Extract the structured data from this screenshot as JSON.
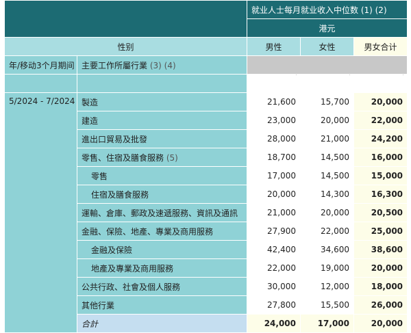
{
  "header": {
    "title": "就业人士每月就业收入中位数 (1) (2)",
    "unit": "港元",
    "col_gender_label": "性别",
    "col_male": "男性",
    "col_female": "女性",
    "col_total": "男女合计"
  },
  "subheader": {
    "period_label": "年/移动3个月期间",
    "industry_label": "主要工作所屬行業",
    "industry_note": "(3) (4)"
  },
  "period": "5/2024 - 7/2024",
  "rows": [
    {
      "label": "製造",
      "note": "",
      "male": "21,600",
      "female": "15,700",
      "total": "20,000"
    },
    {
      "label": "建造",
      "note": "",
      "male": "23,000",
      "female": "20,000",
      "total": "22,000"
    },
    {
      "label": "進出口貿易及批發",
      "note": "",
      "male": "28,000",
      "female": "21,000",
      "total": "24,200"
    },
    {
      "label": "零售、住宿及膳食服務",
      "note": "(5)",
      "male": "18,700",
      "female": "14,500",
      "total": "16,000"
    },
    {
      "label": "零售",
      "note": "",
      "male": "17,000",
      "female": "14,500",
      "total": "15,000"
    },
    {
      "label": "住宿及膳食服務",
      "note": "",
      "male": "20,000",
      "female": "14,300",
      "total": "16,300"
    },
    {
      "label": "運輸、倉庫、郵政及速遞服務、資訊及通訊",
      "note": "",
      "male": "21,000",
      "female": "20,000",
      "total": "20,500"
    },
    {
      "label": "金融、保險、地產、專業及商用服務",
      "note": "",
      "male": "27,900",
      "female": "22,000",
      "total": "25,000"
    },
    {
      "label": "金融及保險",
      "note": "",
      "male": "42,400",
      "female": "34,600",
      "total": "38,600"
    },
    {
      "label": "地產及專業及商用服務",
      "note": "",
      "male": "22,000",
      "female": "19,000",
      "total": "20,000"
    },
    {
      "label": "公共行政、社會及個人服務",
      "note": "",
      "male": "30,000",
      "female": "12,000",
      "total": "18,000"
    },
    {
      "label": "其他行業",
      "note": "",
      "male": "27,800",
      "female": "15,500",
      "total": "26,000"
    }
  ],
  "total_row": {
    "label": "合計",
    "male": "24,000",
    "female": "17,000",
    "total": "20,000"
  },
  "colors": {
    "teal": "#1c6b73",
    "aqua": "#8fd2d6",
    "light_aqua": "#a9dde1",
    "cream": "#fdfde8",
    "gray": "#c8c8c8",
    "total_blue": "#c5def0"
  }
}
